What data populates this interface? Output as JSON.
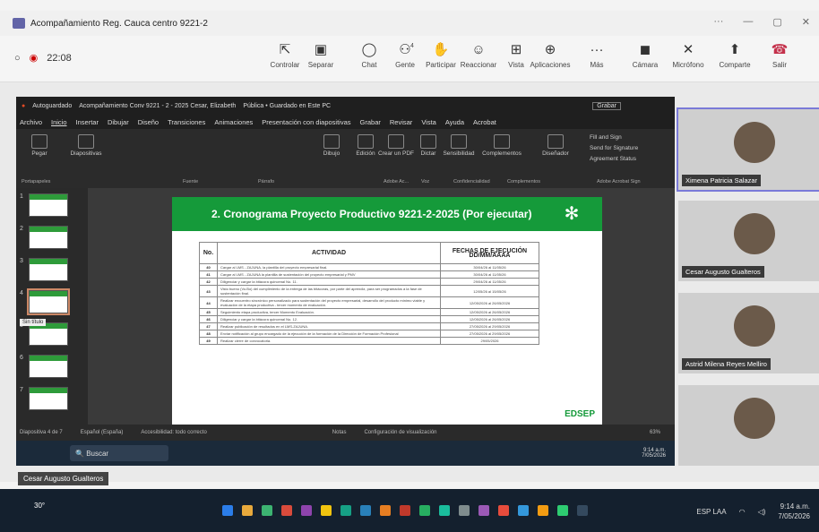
{
  "window": {
    "title": "Acompañamiento Reg. Cauca centro 9221-2",
    "controls": [
      "···",
      "—",
      "▢",
      "✕"
    ]
  },
  "meeting": {
    "time": "22:08"
  },
  "toolbar": [
    {
      "label": "Controlar",
      "icon": "control-icon"
    },
    {
      "label": "Separar",
      "icon": "separate-icon"
    },
    {
      "label": "Chat",
      "icon": "chat-icon"
    },
    {
      "label": "Gente",
      "icon": "people-icon",
      "badge": "4"
    },
    {
      "label": "Participar",
      "icon": "raise-hand-icon"
    },
    {
      "label": "Reaccionar",
      "icon": "react-icon"
    },
    {
      "label": "Vista",
      "icon": "view-icon"
    },
    {
      "label": "Aplicaciones",
      "icon": "apps-icon"
    },
    {
      "label": "Más",
      "icon": "more-icon"
    },
    {
      "label": "Cámara",
      "icon": "camera-icon"
    },
    {
      "label": "Micrófono",
      "icon": "mic-icon"
    },
    {
      "label": "Comparte",
      "icon": "share-icon"
    },
    {
      "label": "Salir",
      "icon": "leave-icon"
    }
  ],
  "powerpoint": {
    "autosave": "Autoguardado",
    "file_title": "Acompañamiento Conv 9221 - 2 - 2025 Cesar, Elizabeth",
    "visibility": "Pública • Guardado en Este PC",
    "record": "Grabar",
    "tabs": [
      "Archivo",
      "Inicio",
      "Insertar",
      "Dibujar",
      "Diseño",
      "Transiciones",
      "Animaciones",
      "Presentación con diapositivas",
      "Grabar",
      "Revisar",
      "Vista",
      "Ayuda",
      "Acrobat"
    ],
    "ribbon_buttons": [
      "Pegar",
      "Diapositivas",
      "Dibujo",
      "Edición",
      "Crear un PDF",
      "Dictar",
      "Sensibilidad",
      "Complementos",
      "Diseñador"
    ],
    "ribbon_sections": [
      "Portapapeles",
      "Fuente",
      "Párrafo",
      "Adobe Ac...",
      "Voz",
      "Confidencialidad",
      "Complementos",
      "Adobe Acrobat Sign"
    ],
    "acrobat_sign": [
      "Fill and Sign",
      "Send for Signature",
      "Agreement Status"
    ],
    "thumbnail_numbers": [
      "1",
      "2",
      "3",
      "4",
      "5",
      "6",
      "7"
    ],
    "tooltip": "Sin título",
    "status": {
      "slide": "Diapositiva 4 de 7",
      "language": "Español (España)",
      "accessibility": "Accesibilidad: todo correcto",
      "notes": "Notas",
      "view_settings": "Configuración de visualización",
      "zoom": "63%"
    },
    "inner_taskbar": {
      "search": "Buscar",
      "lang": "ESP LAA",
      "time": "9:14 a.m.",
      "date": "7/05/2026"
    }
  },
  "slide": {
    "title": "2. Cronograma Proyecto Productivo 9221-2-2025 (Por ejecutar)",
    "headers": {
      "no": "No.",
      "activity": "ACTIVIDAD",
      "dates": "FECHAS DE EJECUCIÓN DD/MM/AAAA"
    },
    "rows": [
      {
        "no": "40",
        "activity": "Cargar al LMS - ZAJUNA, la plantilla del proyecto empresarial final.",
        "date": "30/04/26 al 11/05/26"
      },
      {
        "no": "41",
        "activity": "Cargar al LMS - ZAJUNA la plantilla de sustentación del proyecto empresarial y PMV",
        "date": "30/04/26 al 11/05/26"
      },
      {
        "no": "42",
        "activity": "Diligenciar y cargar la bitácora quincenal No. 11.",
        "date": "29/04/26 al 11/05/26"
      },
      {
        "no": "43",
        "activity": "Visto bueno (Vo.Bo) del cumplimiento de la entrega de las bitácoras, por parte del aprendiz, para ser programados a la fase de sustentación final.",
        "date": "12/05/26 al 15/05/26"
      },
      {
        "no": "44",
        "activity": "Realizar encuentro sincrónico personalizado para sustentación del proyecto empresarial, desarrollo del producto mínimo viable y evaluación de la etapa productiva - tercer momento de evaluación.",
        "date": "12/05/2026 al 26/05/2026"
      },
      {
        "no": "45",
        "activity": "Seguimiento etapa productiva, tercer Momento Evaluación.",
        "date": "12/05/2026 al 26/05/2026"
      },
      {
        "no": "46",
        "activity": "Diligenciar y cargar la bitácora quincenal No. 12.",
        "date": "12/05/2026 al 26/05/2026"
      },
      {
        "no": "47",
        "activity": "Realizar publicación de resultados en el LMS-ZAJUNA.",
        "date": "27/05/2026 al 29/05/2026"
      },
      {
        "no": "48",
        "activity": "Enviar notificación al grupo encargado de la ejecución de la formación de la Dirección de Formación Profesional",
        "date": "27/05/2026 al 29/05/2026"
      },
      {
        "no": "49",
        "activity": "Realizar cierre de convocatoria.",
        "date": "29/05/2026"
      }
    ],
    "logo_text": "SENA",
    "edsep": "EDSEP"
  },
  "participants": [
    {
      "name": "Ximena Patricia Salazar",
      "active": true
    },
    {
      "name": "Cesar Augusto Gualteros",
      "active": false
    },
    {
      "name": "Astrid Milena Reyes Melliro",
      "active": false
    },
    {
      "name": "",
      "active": false
    }
  ],
  "presenter_label": "Cesar Augusto Gualteros",
  "taskbar": {
    "weather": "30°",
    "lang": "ESP LAA",
    "time": "9:14 a.m.",
    "date": "7/05/2026"
  }
}
